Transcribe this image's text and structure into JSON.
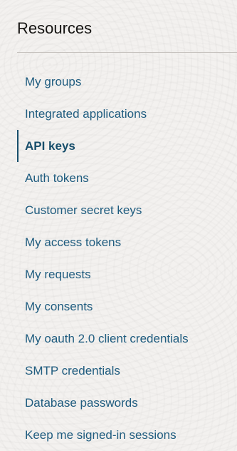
{
  "sidebar": {
    "title": "Resources",
    "active_index": 2,
    "items": [
      {
        "label": "My groups"
      },
      {
        "label": "Integrated applications"
      },
      {
        "label": "API keys"
      },
      {
        "label": "Auth tokens"
      },
      {
        "label": "Customer secret keys"
      },
      {
        "label": "My access tokens"
      },
      {
        "label": "My requests"
      },
      {
        "label": "My consents"
      },
      {
        "label": "My oauth 2.0 client credentials"
      },
      {
        "label": "SMTP credentials"
      },
      {
        "label": "Database passwords"
      },
      {
        "label": "Keep me signed-in sessions"
      }
    ]
  }
}
